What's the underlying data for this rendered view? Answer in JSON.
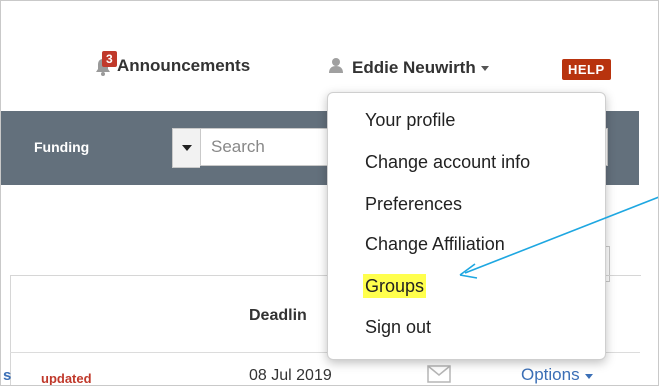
{
  "header": {
    "announcements_label": "Announcements",
    "announcements_count": "3",
    "user_name": "Eddie Neuwirth",
    "help_label": "HELP"
  },
  "toolbar": {
    "funding_label": "Funding",
    "search_placeholder": "Search"
  },
  "user_menu": {
    "items": [
      "Your profile",
      "Change account info",
      "Preferences",
      "Change Affiliation",
      "Groups",
      "Sign out"
    ],
    "highlighted": "Groups"
  },
  "table": {
    "deadline_header": "Deadlin",
    "row": {
      "name_fragment": "s",
      "status": "updated",
      "date": "08 Jul 2019",
      "options_label": "Options"
    }
  },
  "colors": {
    "toolbar_bg": "#63707c",
    "help_bg": "#b8330e",
    "badge_bg": "#c0392b",
    "link": "#3b6fb6",
    "highlight": "#ffff4d",
    "annotation_arrow": "#1ea7e1"
  }
}
